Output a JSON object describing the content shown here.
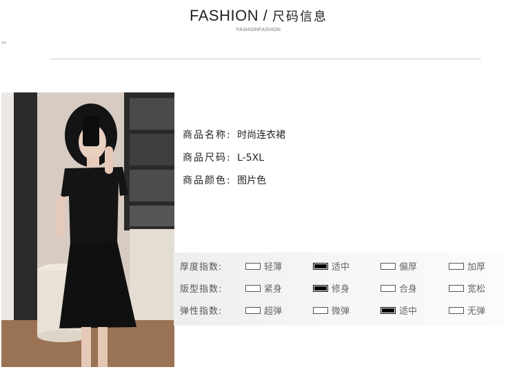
{
  "header": {
    "title_en": "FASHION",
    "title_sep": "/",
    "title_cn": "尺码信息",
    "subtitle": "FASHIONFASHION",
    "scissors_icon": "scissors-icon"
  },
  "product": {
    "rows": [
      {
        "label": "商品名称",
        "value": "时尚连衣裙"
      },
      {
        "label": "商品尺码",
        "value": "L-5XL"
      },
      {
        "label": "商品颜色",
        "value": "图片色"
      }
    ]
  },
  "indices": {
    "rows": [
      {
        "label": "厚度指数:",
        "options": [
          "轻薄",
          "适中",
          "偏厚",
          "加厚"
        ],
        "selected": 1
      },
      {
        "label": "版型指数:",
        "options": [
          "紧身",
          "修身",
          "合身",
          "宽松"
        ],
        "selected": 1
      },
      {
        "label": "弹性指数:",
        "options": [
          "超弹",
          "微弹",
          "适中",
          "无弹"
        ],
        "selected": 2
      }
    ]
  },
  "colors": {
    "accent": "#000000",
    "divider": "#cfcfcf"
  }
}
